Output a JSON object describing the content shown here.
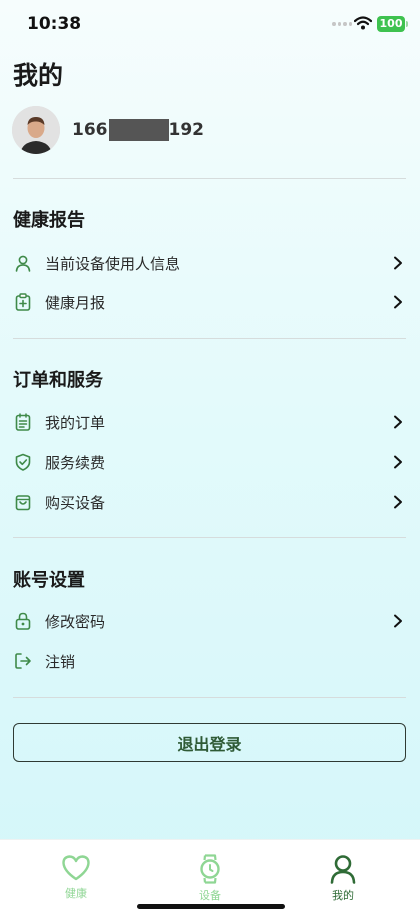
{
  "status_bar": {
    "time": "10:38",
    "battery": "100"
  },
  "page_title": "我的",
  "profile": {
    "phone_prefix": "166",
    "phone_suffix": "192"
  },
  "sections": [
    {
      "title": "健康报告",
      "items": [
        {
          "label": "当前设备使用人信息",
          "icon": "person-icon",
          "chevron": true
        },
        {
          "label": "健康月报",
          "icon": "clipboard-plus-icon",
          "chevron": true
        }
      ]
    },
    {
      "title": "订单和服务",
      "items": [
        {
          "label": "我的订单",
          "icon": "order-list-icon",
          "chevron": true
        },
        {
          "label": "服务续费",
          "icon": "shield-check-icon",
          "chevron": true
        },
        {
          "label": "购买设备",
          "icon": "shopping-bag-icon",
          "chevron": true
        }
      ]
    },
    {
      "title": "账号设置",
      "items": [
        {
          "label": "修改密码",
          "icon": "lock-icon",
          "chevron": true
        },
        {
          "label": "注销",
          "icon": "sign-out-icon",
          "chevron": false
        }
      ]
    }
  ],
  "logout_button": "退出登录",
  "tabbar": {
    "tabs": [
      {
        "label": "健康",
        "icon": "heart-icon",
        "active": false
      },
      {
        "label": "设备",
        "icon": "watch-icon",
        "active": false
      },
      {
        "label": "我的",
        "icon": "user-icon",
        "active": true
      }
    ]
  },
  "colors": {
    "accent_green": "#3f8a49",
    "inactive_tab": "#8fd694",
    "active_tab": "#2f6b36",
    "background_top": "#f6fdfd",
    "background_bottom": "#d3f6f9"
  }
}
